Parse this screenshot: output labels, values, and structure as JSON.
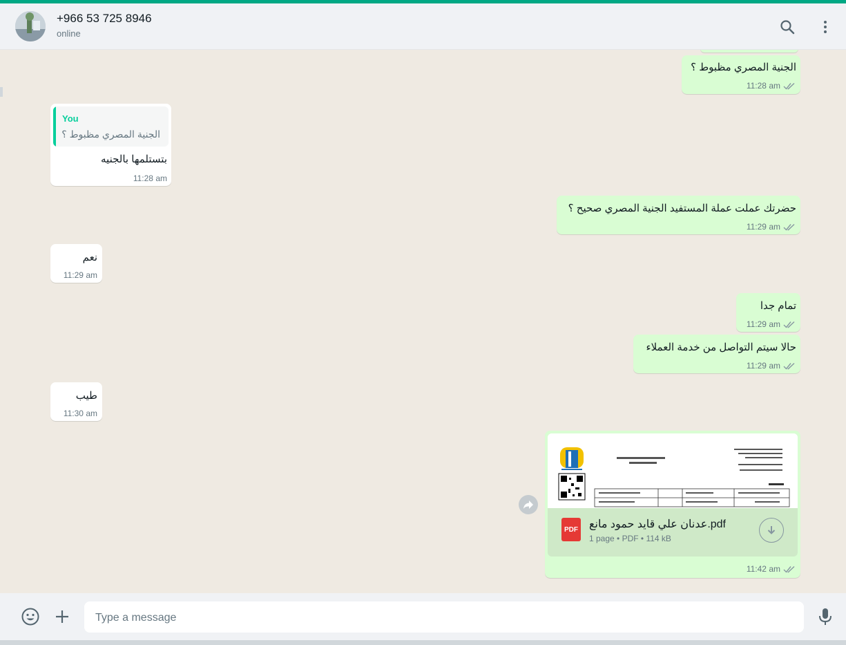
{
  "header": {
    "contact_name": "+966 53 725 8946",
    "status": "online"
  },
  "composer": {
    "placeholder": "Type a message"
  },
  "messages": [
    {
      "text": "الجنية المصري مظبوط ؟",
      "time": "11:28 am",
      "direction": "out"
    },
    {
      "text": "بتستلمها بالجنيه",
      "time": "11:28 am",
      "direction": "in",
      "quote_author": "You",
      "quote_text": "الجنية المصري مظبوط ؟"
    },
    {
      "text": "حضرتك عملت عملة المستفيد الجنية المصري صحيح ؟",
      "time": "11:29 am",
      "direction": "out"
    },
    {
      "text": "نعم",
      "time": "11:29 am",
      "direction": "in"
    },
    {
      "text": "تمام جدا",
      "time": "11:29 am",
      "direction": "out"
    },
    {
      "text": "حالا سيتم التواصل من خدمة العملاء",
      "time": "11:29 am",
      "direction": "out"
    },
    {
      "text": "طيب",
      "time": "11:30 am",
      "direction": "in"
    }
  ],
  "document": {
    "file_name": "عدنان علي قايد حمود مانع.pdf",
    "info": "1 page • PDF • 114 kB",
    "badge": "PDF",
    "time": "11:42 am"
  },
  "colors": {
    "accent": "#00a884",
    "outgoing_bubble": "#d9fdd3",
    "incoming_bubble": "#ffffff",
    "chat_background": "#efeae2",
    "read_tick": "#8696a0"
  }
}
